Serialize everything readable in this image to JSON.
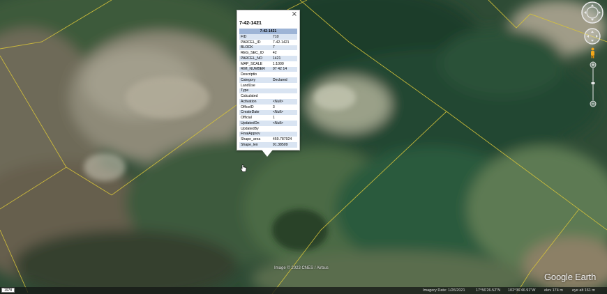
{
  "popup": {
    "close_glyph": "×",
    "title": "7-42-1421",
    "header": "7-42-1421",
    "rows": [
      {
        "label": "FID",
        "value": "710"
      },
      {
        "label": "PARCEL_ID",
        "value": "7-42-1421"
      },
      {
        "label": "BLOCK",
        "value": "7"
      },
      {
        "label": "REG_SEC_ID",
        "value": "42"
      },
      {
        "label": "PARCEL_NO",
        "value": "1421"
      },
      {
        "label": "MAP_SCALE",
        "value": "1:1000"
      },
      {
        "label": "RIM_NUMBER",
        "value": "07 42 14"
      },
      {
        "label": "Descriptio",
        "value": ""
      },
      {
        "label": "Category",
        "value": "Declared"
      },
      {
        "label": "LandUse",
        "value": ""
      },
      {
        "label": "Type",
        "value": ""
      },
      {
        "label": "Calculated",
        "value": ""
      },
      {
        "label": "Activation",
        "value": "<Null>"
      },
      {
        "label": "OfficeID",
        "value": "3"
      },
      {
        "label": "CreateDate",
        "value": "<Null>"
      },
      {
        "label": "Official",
        "value": "1"
      },
      {
        "label": "UpdatedOn",
        "value": "<Null>"
      },
      {
        "label": "UpdatedBy",
        "value": ""
      },
      {
        "label": "FinalApprov",
        "value": ""
      },
      {
        "label": "Shape_area",
        "value": "459.787924"
      },
      {
        "label": "Shape_len",
        "value": "91.38509"
      }
    ]
  },
  "map": {
    "credit": "Image © 2023 CNES / Airbus",
    "brand": "Google Earth"
  },
  "status_bar": {
    "scale_label": "1978",
    "imagery_date": "Imagery Date: 1/26/2021",
    "latitude": "17°56'26.52\"N",
    "longitude": "102°36'46.91\"W",
    "elevation": "elev  174 m",
    "eye_alt": "eye alt  161 m"
  },
  "colors": {
    "parcel_line": "#d6c33a",
    "popup_header": "#9db4d6",
    "popup_row_alt": "#d9e4f2"
  },
  "icons": [
    "close-icon",
    "hand-cursor-icon",
    "look-navigation-icon",
    "move-navigation-icon",
    "street-view-pegman-icon",
    "zoom-slider-icon"
  ]
}
